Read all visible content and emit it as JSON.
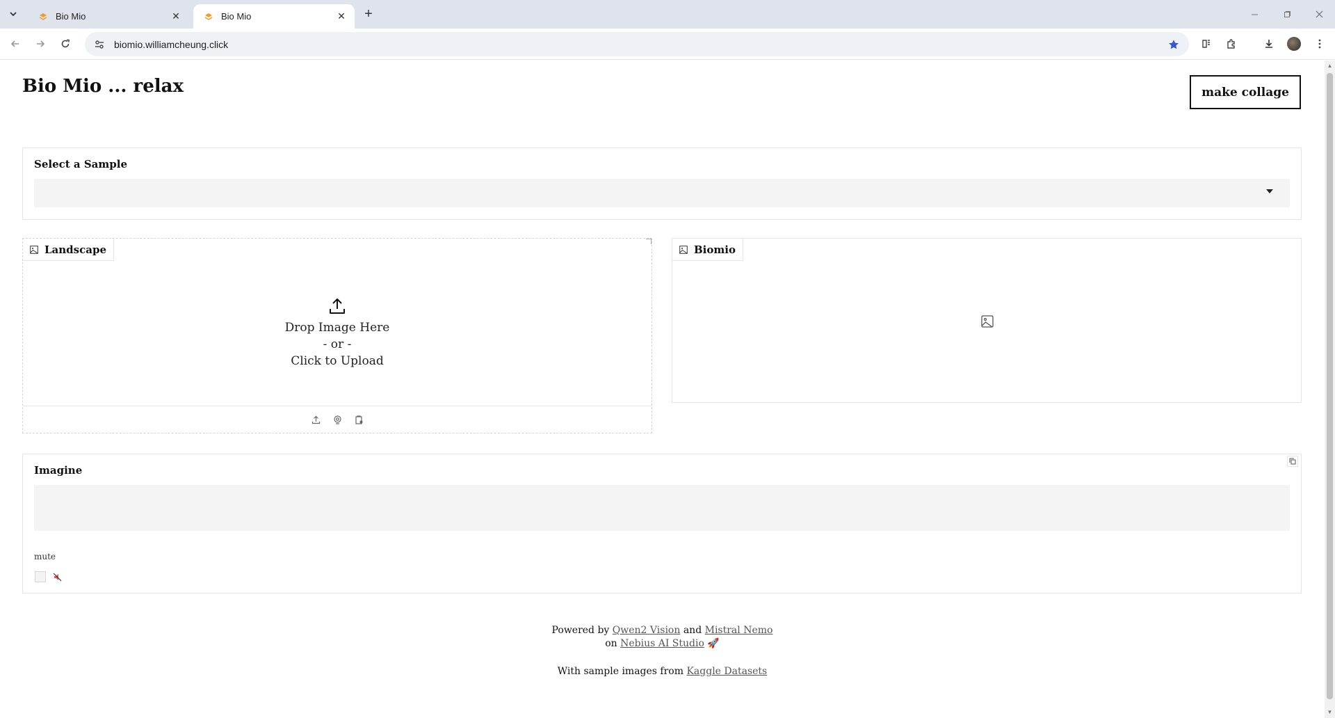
{
  "browser": {
    "tabs": [
      {
        "title": "Bio Mio",
        "active": false
      },
      {
        "title": "Bio Mio",
        "active": true
      }
    ],
    "url": "biomio.williamcheung.click",
    "bookmark_color": "#3b57c4"
  },
  "header": {
    "title": "Bio Mio ... relax",
    "collage_button": "make collage"
  },
  "sample": {
    "label": "Select a Sample",
    "selected_value": ""
  },
  "landscape": {
    "label": "Landscape",
    "drop_line1": "Drop Image Here",
    "drop_line2": "- or -",
    "drop_line3": "Click to Upload",
    "tools": [
      "upload-icon",
      "webcam-icon",
      "clipboard-icon"
    ]
  },
  "biomio": {
    "label": "Biomio"
  },
  "imagine": {
    "label": "Imagine",
    "value": "",
    "mute_label": "mute",
    "mute_checked": false
  },
  "footer": {
    "powered_by": "Powered by",
    "link1": "Qwen2 Vision",
    "and": "and",
    "link2": "Mistral Nemo",
    "on": "on",
    "link3": "Nebius AI Studio",
    "rocket": "🚀",
    "sample_text": "With sample images from",
    "link4": "Kaggle Datasets"
  }
}
